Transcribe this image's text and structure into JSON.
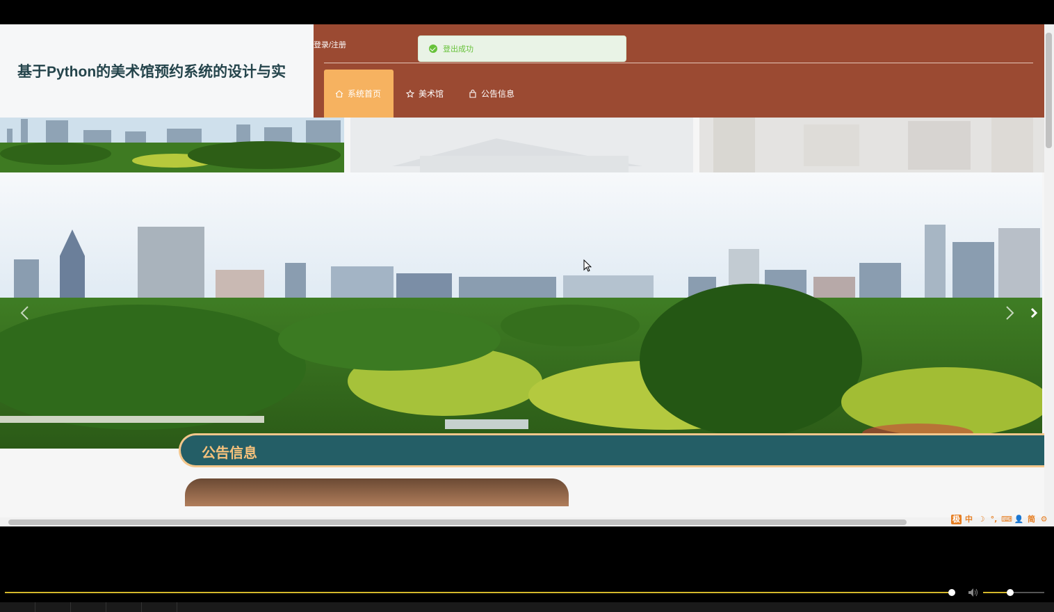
{
  "header": {
    "site_title": "基于Python的美术馆预约系统的设计与实",
    "login_link": "登录/注册",
    "colors": {
      "nav_bg": "#9b4a32",
      "active_tab": "#f6b260",
      "title_color": "#24444b"
    }
  },
  "nav": {
    "items": [
      {
        "label": "系统首页",
        "icon": "home-icon",
        "active": true
      },
      {
        "label": "美术馆",
        "icon": "star-icon",
        "active": false
      },
      {
        "label": "公告信息",
        "icon": "bag-icon",
        "active": false
      }
    ]
  },
  "toast": {
    "message": "登出成功",
    "icon": "check-circle-icon",
    "color": "#67c23a"
  },
  "carousel": {
    "thumbnails": [
      "city-park-panorama",
      "museum-building",
      "gallery-interior"
    ],
    "hero_image": "city-park-panorama",
    "prev_icon": "chevron-left-icon",
    "next_icon": "chevron-right-icon"
  },
  "notice_section": {
    "title": "公告信息",
    "colors": {
      "bar_bg": "#245e66",
      "bar_border": "#f3c68b",
      "title_color": "#f6c27c"
    }
  },
  "ime_toolbar": {
    "buttons": [
      "极",
      "中",
      "☽",
      "°,",
      "⌨",
      "👤",
      "简",
      "⚙"
    ]
  },
  "player": {
    "progress_fraction": 0.995,
    "volume_fraction": 0.4,
    "accent_color": "#d4b82b"
  }
}
